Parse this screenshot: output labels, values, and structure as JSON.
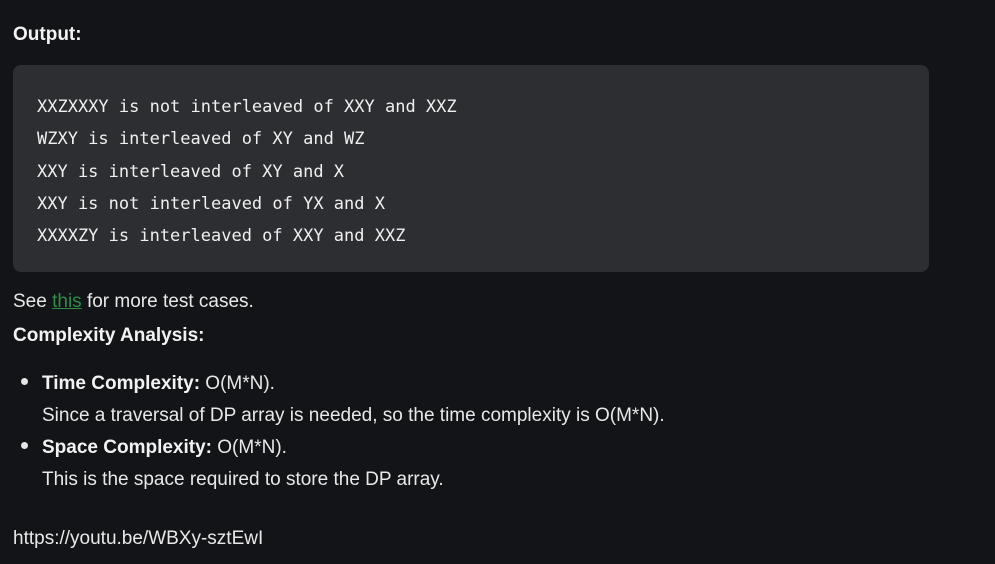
{
  "output_heading": "Output:",
  "code_lines": [
    "XXZXXXY is not interleaved of XXY and XXZ",
    "WZXY is interleaved of XY and WZ",
    "XXY is interleaved of XY and X",
    "XXY is not interleaved of YX and X",
    "XXXXZY is interleaved of XXY and XXZ"
  ],
  "see_line": {
    "prefix": "See ",
    "link_text": "this",
    "suffix": " for more test cases."
  },
  "complexity_heading": "Complexity Analysis:",
  "complexity_items": [
    {
      "title": "Time Complexity:",
      "value": " O(M*N).",
      "detail": "Since a traversal of DP array is needed, so the time complexity is O(M*N)."
    },
    {
      "title": "Space Complexity:",
      "value": " O(M*N).",
      "detail": "This is the space required to store the DP array."
    }
  ],
  "video_url": "https://youtu.be/WBXy-sztEwI",
  "colors": {
    "background": "#131417",
    "code_background": "#2d2e32",
    "link": "#2f8d46"
  }
}
